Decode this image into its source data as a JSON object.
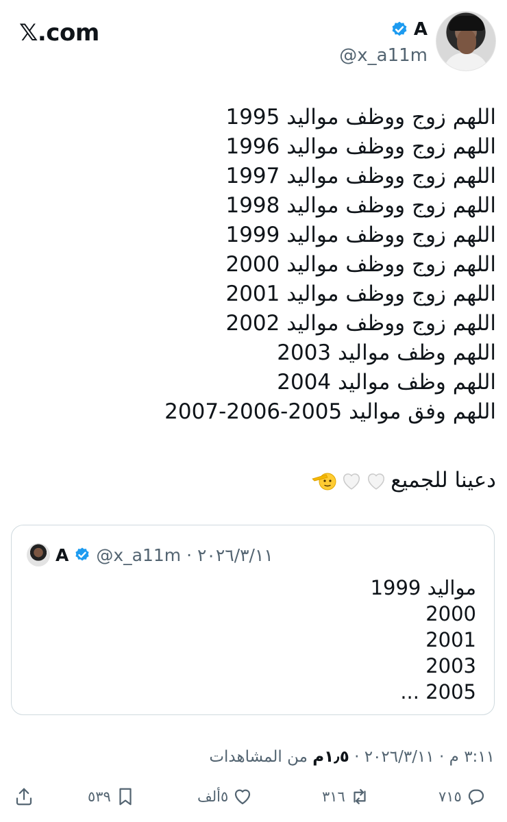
{
  "header": {
    "site_logo": "𝕏.com",
    "author_name": "A",
    "author_handle": "@x_a11m"
  },
  "tweet": {
    "lines": [
      "اللهم زوج ووظف مواليد 1995",
      "اللهم زوج ووظف مواليد 1996",
      "اللهم زوج ووظف مواليد 1997",
      "اللهم زوج ووظف مواليد 1998",
      "اللهم زوج ووظف مواليد 1999",
      "اللهم زوج ووظف مواليد 2000",
      "اللهم زوج ووظف مواليد 2001",
      "اللهم زوج ووظف مواليد 2002",
      "اللهم وظف مواليد 2003",
      "اللهم وظف مواليد 2004",
      "اللهم وفق مواليد 2005-2006-2007"
    ],
    "prayer_text": "دعينا للجميع",
    "emoji_names": [
      "white-heart-icon",
      "white-heart-icon",
      "saluting-face-icon"
    ]
  },
  "quote": {
    "author_name": "A",
    "meta": "@x_a11m · ٢٠٢٦/٣/١١",
    "lines": [
      "مواليد 1999",
      "2000",
      "2001",
      "2003",
      "2005 ..."
    ]
  },
  "footer": {
    "timestamp_prefix": "٣:١١ م · ٢٠٢٦/٣/١١ · ",
    "views_count": "١٫٥م",
    "views_label": " من المشاهدات"
  },
  "actions": {
    "replies": "٧١٥",
    "reposts": "٣١٦",
    "likes": "٥ألف",
    "bookmarks": "٥٣٩"
  },
  "colors": {
    "verified": "#1d9bf0",
    "secondary_text": "#536471",
    "primary_text": "#0f1419",
    "border": "#cfd9de"
  }
}
